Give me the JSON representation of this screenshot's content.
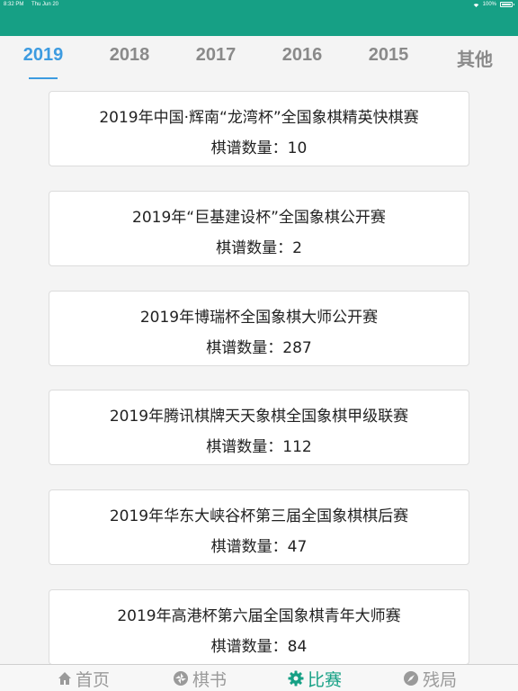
{
  "status_bar": {
    "time": "8:32 PM",
    "date": "Thu Jun 20",
    "battery": "100%"
  },
  "tabs": [
    {
      "label": "2019",
      "active": true
    },
    {
      "label": "2018",
      "active": false
    },
    {
      "label": "2017",
      "active": false
    },
    {
      "label": "2016",
      "active": false
    },
    {
      "label": "2015",
      "active": false
    },
    {
      "label": "其他",
      "active": false
    }
  ],
  "tournaments": [
    {
      "title": "2019年中国·辉南“龙湾杯”全国象棋精英快棋赛",
      "count_label": "棋谱数量：",
      "count": "10"
    },
    {
      "title": "2019年“巨基建设杯”全国象棋公开赛",
      "count_label": "棋谱数量：",
      "count": "2"
    },
    {
      "title": "2019年博瑞杯全国象棋大师公开赛",
      "count_label": "棋谱数量：",
      "count": "287"
    },
    {
      "title": "2019年腾讯棋牌天天象棋全国象棋甲级联赛",
      "count_label": "棋谱数量：",
      "count": "112"
    },
    {
      "title": "2019年华东大峡谷杯第三届全国象棋棋后赛",
      "count_label": "棋谱数量：",
      "count": "47"
    },
    {
      "title": "2019年高港杯第六届全国象棋青年大师赛",
      "count_label": "棋谱数量：",
      "count": "84"
    }
  ],
  "bottom_nav": [
    {
      "label": "首页",
      "icon": "home-icon",
      "active": false
    },
    {
      "label": "棋书",
      "icon": "aperture-icon",
      "active": false
    },
    {
      "label": "比赛",
      "icon": "gear-icon",
      "active": true
    },
    {
      "label": "残局",
      "icon": "compass-icon",
      "active": false
    }
  ],
  "colors": {
    "header": "#16a085",
    "accent": "#3d9be0",
    "active_nav": "#16a085"
  }
}
